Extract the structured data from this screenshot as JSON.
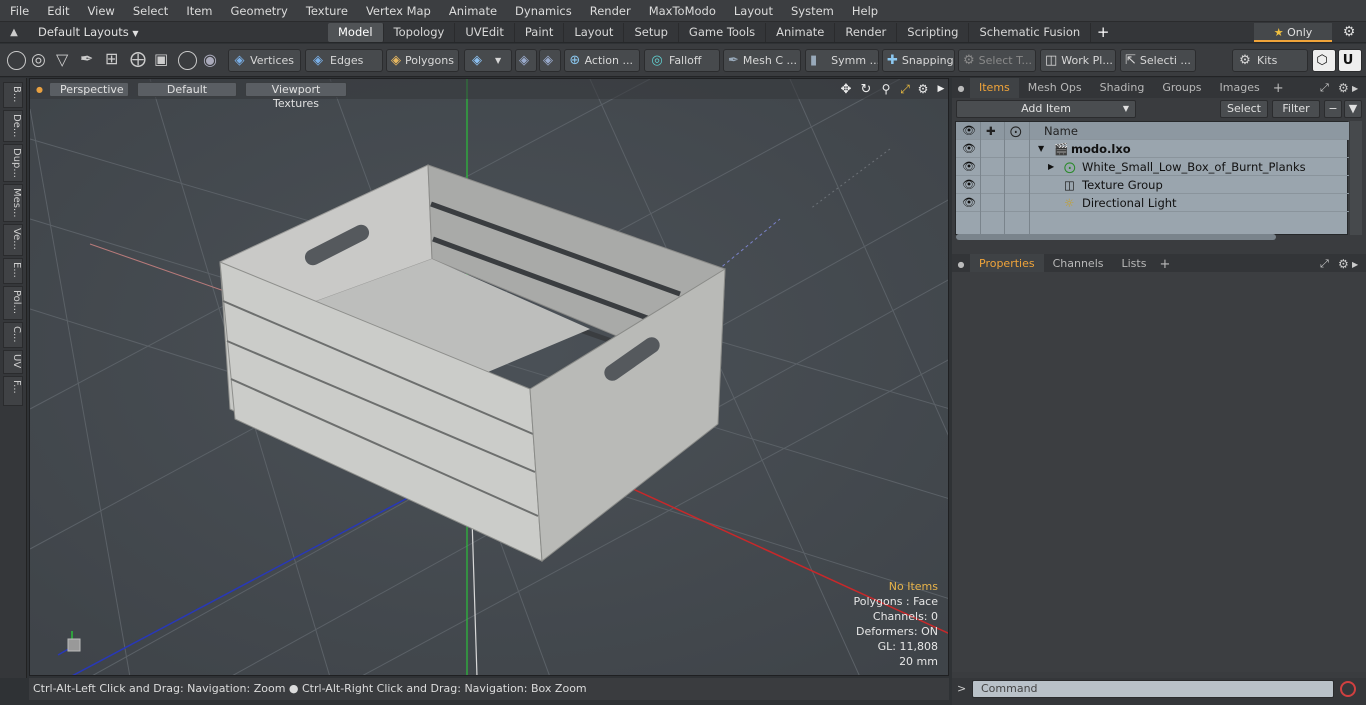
{
  "menu": [
    "File",
    "Edit",
    "View",
    "Select",
    "Item",
    "Geometry",
    "Texture",
    "Vertex Map",
    "Animate",
    "Dynamics",
    "Render",
    "MaxToModo",
    "Layout",
    "System",
    "Help"
  ],
  "layout": {
    "name": "Default Layouts",
    "tabs": [
      "Model",
      "Topology",
      "UVEdit",
      "Paint",
      "Layout",
      "Setup",
      "Game Tools",
      "Animate",
      "Render",
      "Scripting",
      "Schematic Fusion"
    ],
    "active_tab": "Model",
    "only_label": "Only"
  },
  "toolbar": {
    "vertices": "Vertices",
    "edges": "Edges",
    "polygons": "Polygons",
    "action": "Action ...",
    "falloff": "Falloff",
    "mesh": "Mesh C ...",
    "symm": "Symm ...",
    "snapping": "Snapping",
    "select_t": "Select T...",
    "workpl": "Work Pl...",
    "selecti": "Selecti ...",
    "kits": "Kits"
  },
  "left_tabs": [
    "B...",
    "De...",
    "Dup...",
    "Mes...",
    "Ve...",
    "E...",
    "Pol...",
    "C...",
    "UV",
    "F..."
  ],
  "viewport": {
    "view": "Perspective",
    "shading": "Default",
    "textures": "Viewport Textures",
    "info": {
      "items": "No Items",
      "polygons": "Polygons : Face",
      "channels": "Channels: 0",
      "deformers": "Deformers: ON",
      "gl": "GL: 11,808",
      "units": "20 mm"
    }
  },
  "status": "Ctrl-Alt-Left Click and Drag: Navigation: Zoom ● Ctrl-Alt-Right Click and Drag: Navigation: Box Zoom",
  "items_panel": {
    "tabs": [
      "Items",
      "Mesh Ops",
      "Shading",
      "Groups",
      "Images"
    ],
    "active_tab": "Items",
    "add_item": "Add Item",
    "select": "Select",
    "filter": "Filter",
    "name_header": "Name",
    "rows": [
      {
        "label": "modo.lxo",
        "bold": true
      },
      {
        "label": "White_Small_Low_Box_of_Burnt_Planks",
        "bold": false
      },
      {
        "label": "Texture Group",
        "bold": false
      },
      {
        "label": "Directional Light",
        "bold": false
      }
    ]
  },
  "properties_panel": {
    "tabs": [
      "Properties",
      "Channels",
      "Lists"
    ],
    "active_tab": "Properties"
  },
  "command": {
    "placeholder": "Command"
  },
  "colors": {
    "accent": "#f0a43a",
    "x_axis": "#c8282a",
    "y_axis": "#2bbf3a",
    "z_axis": "#2838b8"
  }
}
